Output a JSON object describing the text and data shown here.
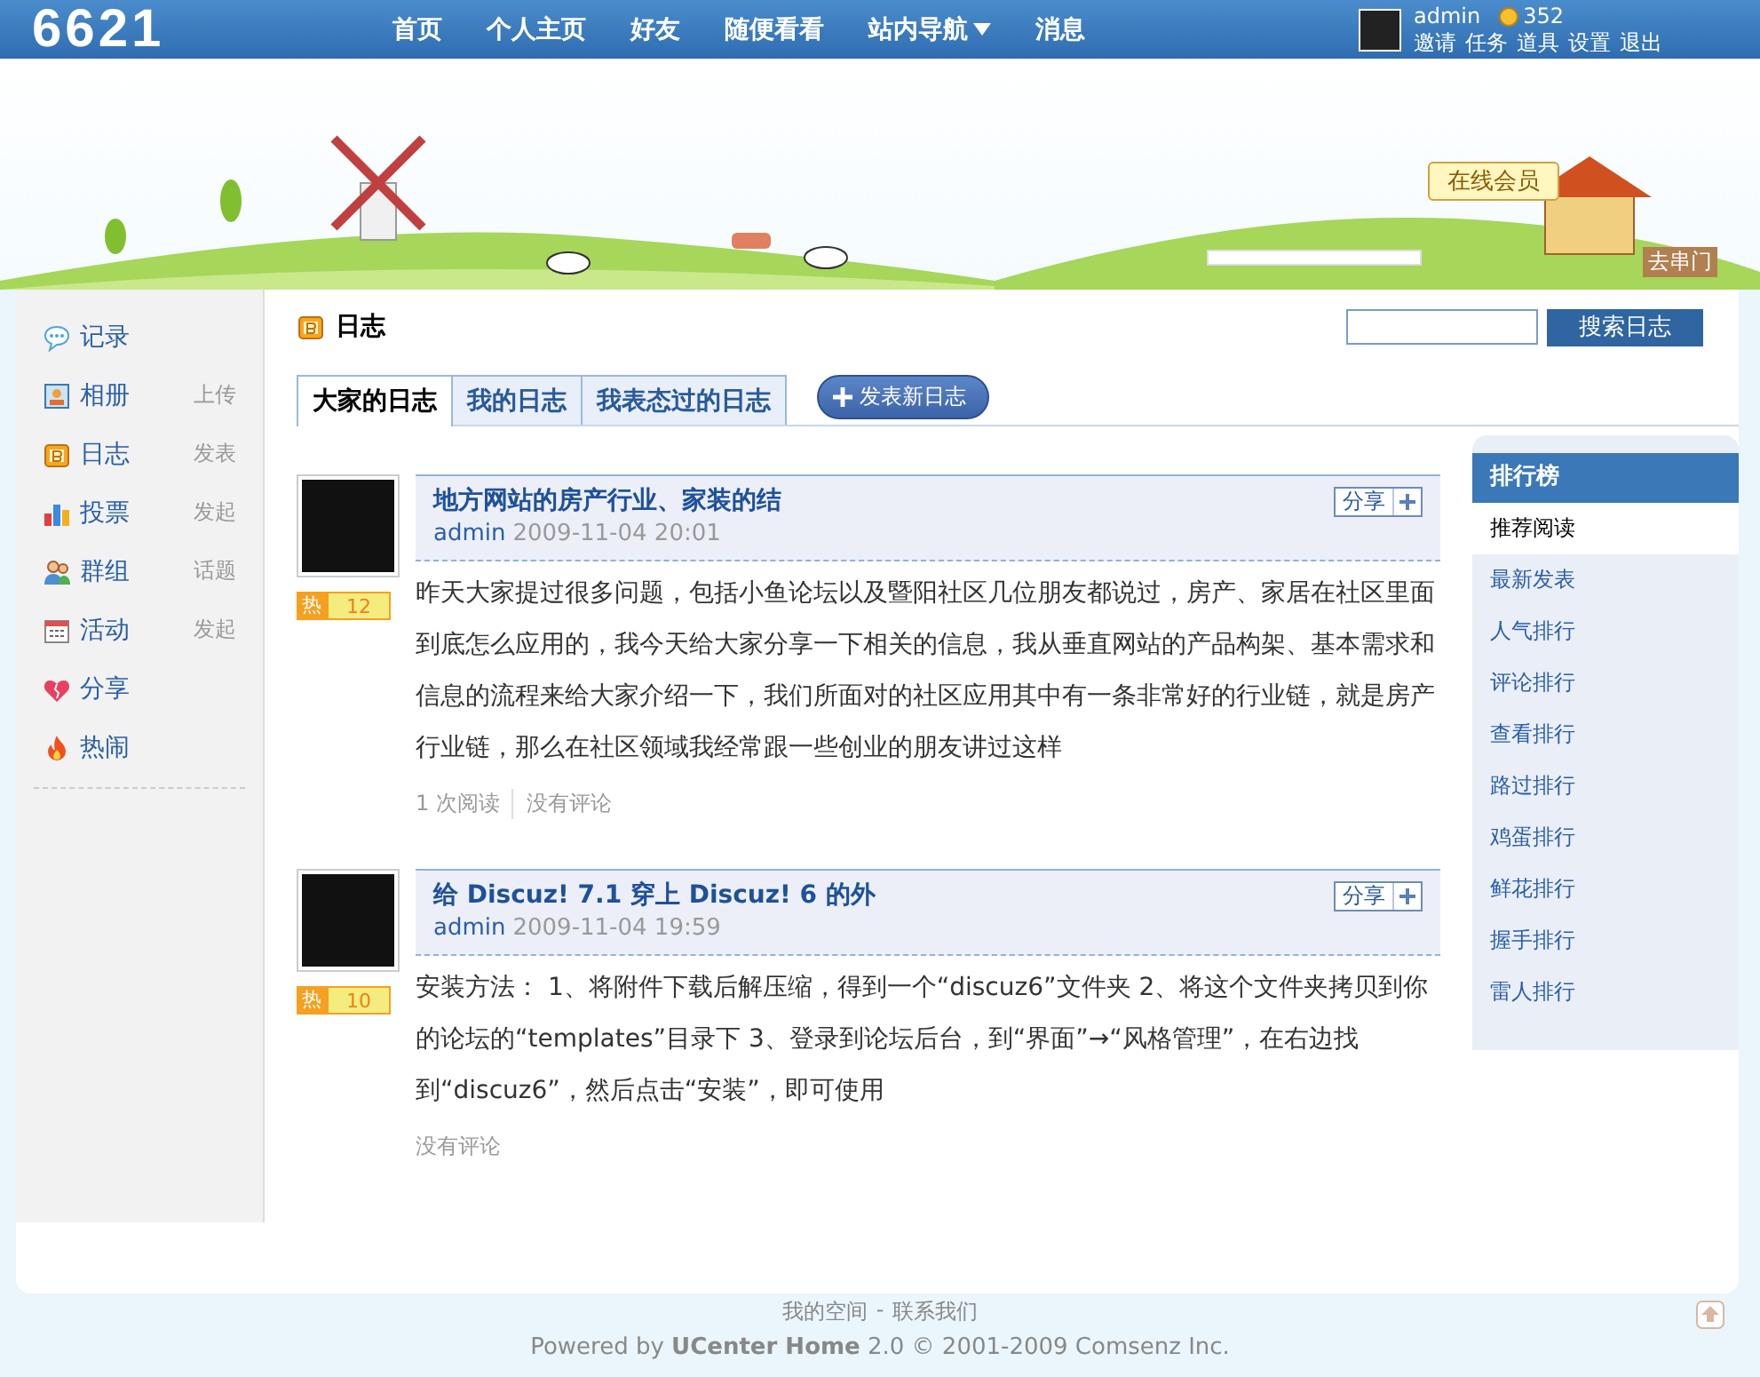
{
  "top_bar": {
    "logo": "6621",
    "nav": [
      {
        "label": "首页",
        "dropdown": false
      },
      {
        "label": "个人主页",
        "dropdown": false
      },
      {
        "label": "好友",
        "dropdown": false
      },
      {
        "label": "随便看看",
        "dropdown": false
      },
      {
        "label": "站内导航",
        "dropdown": true
      },
      {
        "label": "消息",
        "dropdown": false
      }
    ],
    "user": {
      "name": "admin",
      "credits": "352",
      "links": [
        "邀请",
        "任务",
        "道具",
        "设置",
        "退出"
      ]
    }
  },
  "banner": {
    "online_sign": "在线会员",
    "visit_sign": "去串门"
  },
  "sidebar": {
    "items": [
      {
        "label": "记录"
      },
      {
        "label": "相册",
        "action": "上传"
      },
      {
        "label": "日志",
        "action": "发表"
      },
      {
        "label": "投票",
        "action": "发起"
      },
      {
        "label": "群组",
        "action": "话题"
      },
      {
        "label": "活动",
        "action": "发起"
      },
      {
        "label": "分享"
      },
      {
        "label": "热闹"
      }
    ]
  },
  "page": {
    "title": "日志",
    "search_button": "搜索日志",
    "tabs": [
      {
        "label": "大家的日志",
        "selected": true
      },
      {
        "label": "我的日志",
        "selected": false
      },
      {
        "label": "我表态过的日志",
        "selected": false
      }
    ],
    "new_button": "发表新日志"
  },
  "posts": [
    {
      "title": "地方网站的房产行业、家装的结",
      "author": "admin",
      "time": "2009-11-04 20:01",
      "share": "分享",
      "hot_label": "热",
      "hot_count": "12",
      "body": "昨天大家提过很多问题，包括小鱼论坛以及暨阳社区几位朋友都说过，房产、家居在社区里面到底怎么应用的，我今天给大家分享一下相关的信息，我从垂直网站的产品构架、基本需求和信息的流程来给大家介绍一下，我们所面对的社区应用其中有一条非常好的行业链，就是房产行业链，那么在社区领域我经常跟一些创业的朋友讲过这样",
      "stats": [
        "1 次阅读",
        "没有评论"
      ]
    },
    {
      "title": "给  Discuz! 7.1 穿上  Discuz! 6 的外",
      "author": "admin",
      "time": "2009-11-04 19:59",
      "share": "分享",
      "hot_label": "热",
      "hot_count": "10",
      "body": "安装方法：  1、将附件下载后解压缩，得到一个“discuz6”文件夹  2、将这个文件夹拷贝到你的论坛的“templates”目录下  3、登录到论坛后台，到“界面”→“风格管理”，在右边找到“discuz6”，然后点击“安装”，即可使用",
      "stats": [
        "没有评论"
      ]
    }
  ],
  "ranking": {
    "title": "排行榜",
    "items": [
      {
        "label": "推荐阅读",
        "selected": true
      },
      {
        "label": "最新发表",
        "selected": false
      },
      {
        "label": "人气排行",
        "selected": false
      },
      {
        "label": "评论排行",
        "selected": false
      },
      {
        "label": "查看排行",
        "selected": false
      },
      {
        "label": "路过排行",
        "selected": false
      },
      {
        "label": "鸡蛋排行",
        "selected": false
      },
      {
        "label": "鲜花排行",
        "selected": false
      },
      {
        "label": "握手排行",
        "selected": false
      },
      {
        "label": "雷人排行",
        "selected": false
      }
    ]
  },
  "footer": {
    "links": [
      "我的空间",
      "联系我们"
    ],
    "separator": "-",
    "powered": "Powered by **UCenter Home** 2.0 © 2001-2009 Comsenz Inc."
  }
}
